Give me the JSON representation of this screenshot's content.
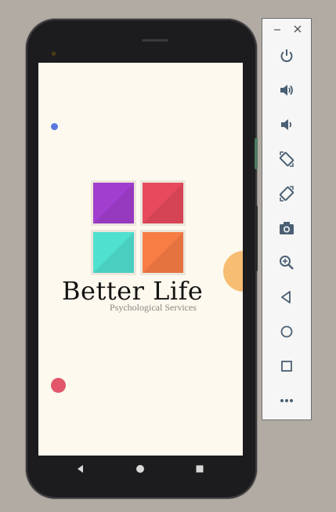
{
  "app": {
    "brand_name": "Better Life",
    "tagline": "Psychological Services"
  },
  "colors": {
    "screen_bg": "#fdf9ee",
    "tile_purple": "#a23ecf",
    "tile_red": "#e64a5c",
    "tile_teal": "#4fe0cf",
    "tile_orange": "#f77d45",
    "dot_blue": "#5a78e0",
    "dot_red": "#e2556a",
    "dot_orange": "#f7bd72",
    "panel_icon": "#4a5f73"
  },
  "nav_bar": {
    "items": [
      "back-icon",
      "home-icon",
      "recents-icon"
    ]
  },
  "emulator_panel": {
    "window_controls": [
      "minimize-icon",
      "close-icon"
    ],
    "tools": [
      "power-icon",
      "volume-up-icon",
      "volume-down-icon",
      "rotate-left-icon",
      "rotate-right-icon",
      "screenshot-icon",
      "zoom-icon",
      "back-icon",
      "home-icon",
      "overview-icon",
      "more-icon"
    ]
  }
}
